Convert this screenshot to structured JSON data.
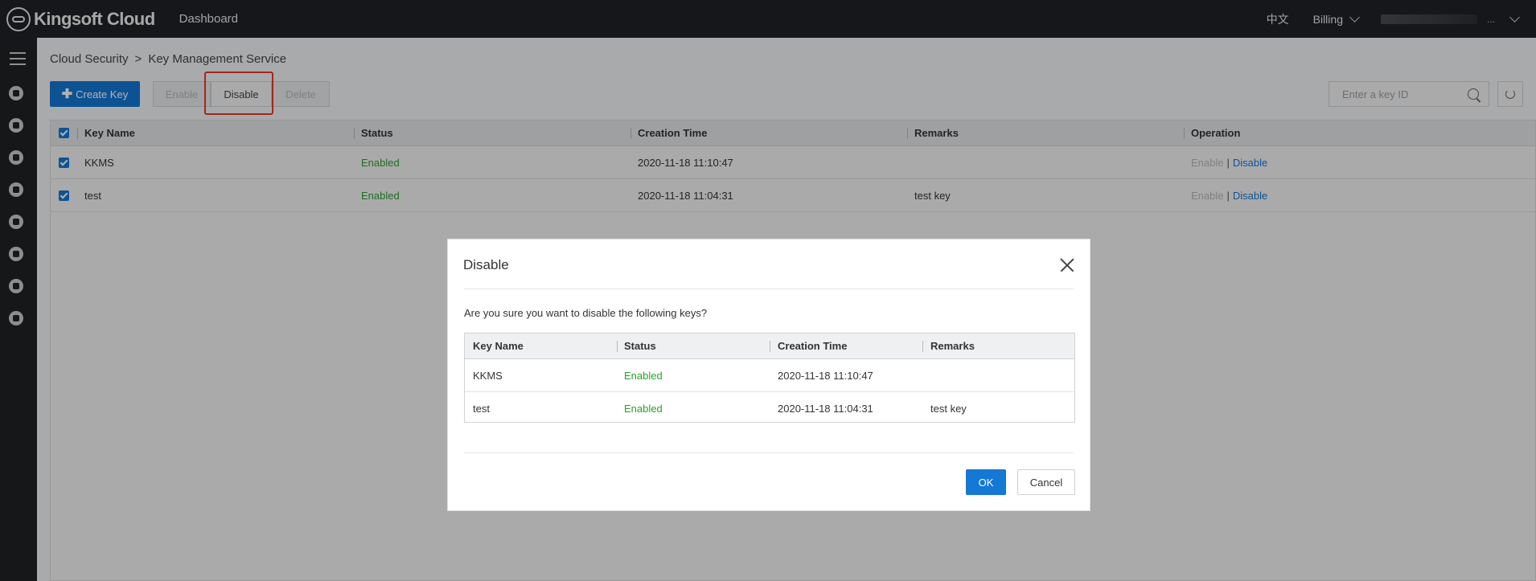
{
  "topbar": {
    "logo_text": "Kingsoft Cloud",
    "nav_dashboard": "Dashboard",
    "lang": "中文",
    "billing": "Billing",
    "account_dots": "..."
  },
  "sidebar": {
    "icons": [
      "menu-icon",
      "security-icon",
      "user-icon",
      "data-icon",
      "database-icon",
      "monitor-icon",
      "network-icon",
      "cloud-icon",
      "id-icon"
    ]
  },
  "breadcrumb": {
    "parent": "Cloud Security",
    "separator": ">",
    "current": "Key Management Service"
  },
  "toolbar": {
    "create_label": "Create Key",
    "enable_label": "Enable",
    "disable_label": "Disable",
    "delete_label": "Delete",
    "search_placeholder": "Enter a key ID"
  },
  "table": {
    "headers": {
      "name": "Key Name",
      "status": "Status",
      "created": "Creation Time",
      "remarks": "Remarks",
      "operation": "Operation"
    },
    "rows": [
      {
        "name": "KKMS",
        "status": "Enabled",
        "created": "2020-11-18 11:10:47",
        "remarks": "",
        "op_enable": "Enable",
        "op_sep": "|",
        "op_disable": "Disable"
      },
      {
        "name": "test",
        "status": "Enabled",
        "created": "2020-11-18 11:04:31",
        "remarks": "test key",
        "op_enable": "Enable",
        "op_sep": "|",
        "op_disable": "Disable"
      }
    ]
  },
  "modal": {
    "title": "Disable",
    "message": "Are you sure you want to disable the following keys?",
    "headers": {
      "name": "Key Name",
      "status": "Status",
      "created": "Creation Time",
      "remarks": "Remarks"
    },
    "rows": [
      {
        "name": "KKMS",
        "status": "Enabled",
        "created": "2020-11-18 11:10:47",
        "remarks": ""
      },
      {
        "name": "test",
        "status": "Enabled",
        "created": "2020-11-18 11:04:31",
        "remarks": "test key"
      }
    ],
    "ok_label": "OK",
    "cancel_label": "Cancel"
  },
  "colors": {
    "accent": "#1478d4",
    "status_green": "#2ca02c",
    "highlight_red": "#e8392c",
    "topbar": "#202226"
  }
}
